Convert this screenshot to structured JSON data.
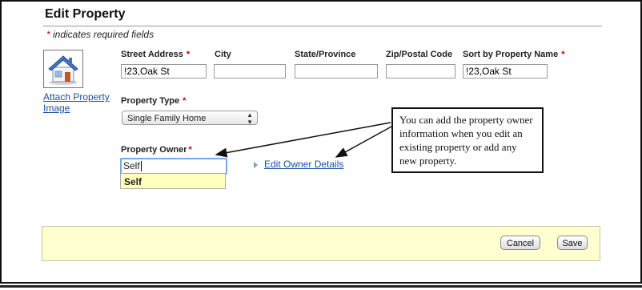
{
  "page": {
    "title": "Edit Property"
  },
  "required_note": {
    "star": "*",
    "text": " indicates required fields"
  },
  "image_section": {
    "icon": "house-icon",
    "attach_link": "Attach Property Image"
  },
  "address": {
    "street": {
      "label": "Street Address",
      "required": "*",
      "value": "!23,Oak St"
    },
    "city": {
      "label": "City",
      "value": ""
    },
    "state": {
      "label": "State/Province",
      "value": ""
    },
    "zip": {
      "label": "Zip/Postal Code",
      "value": ""
    },
    "sort_name": {
      "label": "Sort by Property Name",
      "required": "*",
      "value": "!23,Oak St"
    }
  },
  "property_type": {
    "label": "Property Type",
    "required": "*",
    "selected": "Single Family Home"
  },
  "property_owner": {
    "label": "Property Owner",
    "required": "*",
    "value": "Self",
    "suggestion": "Self"
  },
  "edit_owner_link": "Edit Owner Details",
  "callout_text": "You can add the property owner information when you edit an existing property or add any new property.",
  "footer": {
    "cancel": "Cancel",
    "save": "Save"
  },
  "colors": {
    "link": "#1a4fa3",
    "footer_bg": "#ffffd0",
    "required_star": "#cc0000",
    "suggestion_bg": "#ffffbe"
  }
}
